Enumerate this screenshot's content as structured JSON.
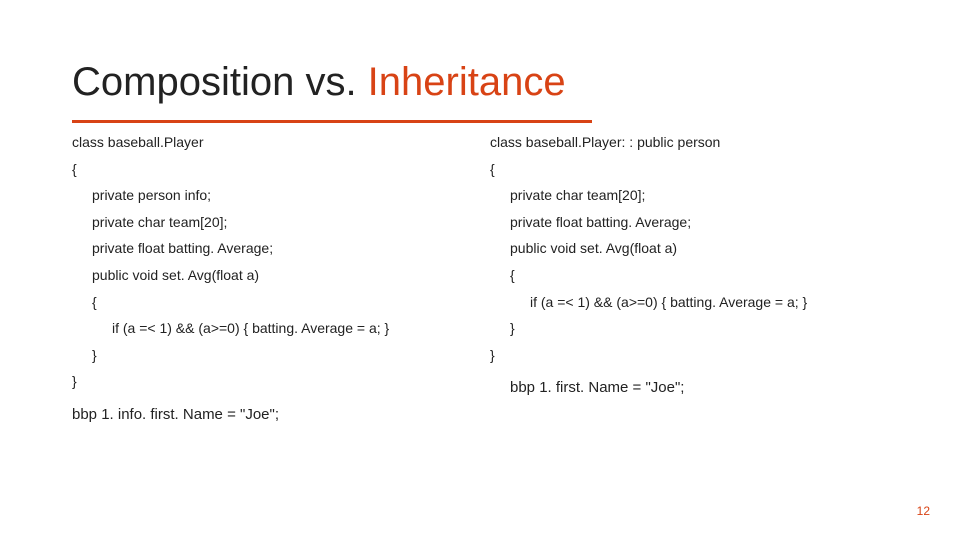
{
  "title": {
    "pre": "Composition vs. ",
    "em": "Inheritance"
  },
  "left": {
    "l0": "class baseball.Player",
    "l1": "{",
    "l2": "private person info;",
    "l3": "private char team[20];",
    "l4": "private float batting. Average;",
    "l5": "public void set. Avg(float a)",
    "l6": "{",
    "l7": "if (a =< 1) && (a>=0) { batting. Average = a; }",
    "l8": "}",
    "l9": "}",
    "call": "bbp 1. info. first. Name = \"Joe\";"
  },
  "right": {
    "l0": "class baseball.Player: : public person",
    "l1": "{",
    "l2": "private char team[20];",
    "l3": "private float batting. Average;",
    "l4": "public void set. Avg(float a)",
    "l5": "{",
    "l6": "if (a =< 1) && (a>=0) { batting. Average = a; }",
    "l7": "}",
    "l8": "}",
    "call": "bbp 1. first. Name = \"Joe\";"
  },
  "page": "12"
}
